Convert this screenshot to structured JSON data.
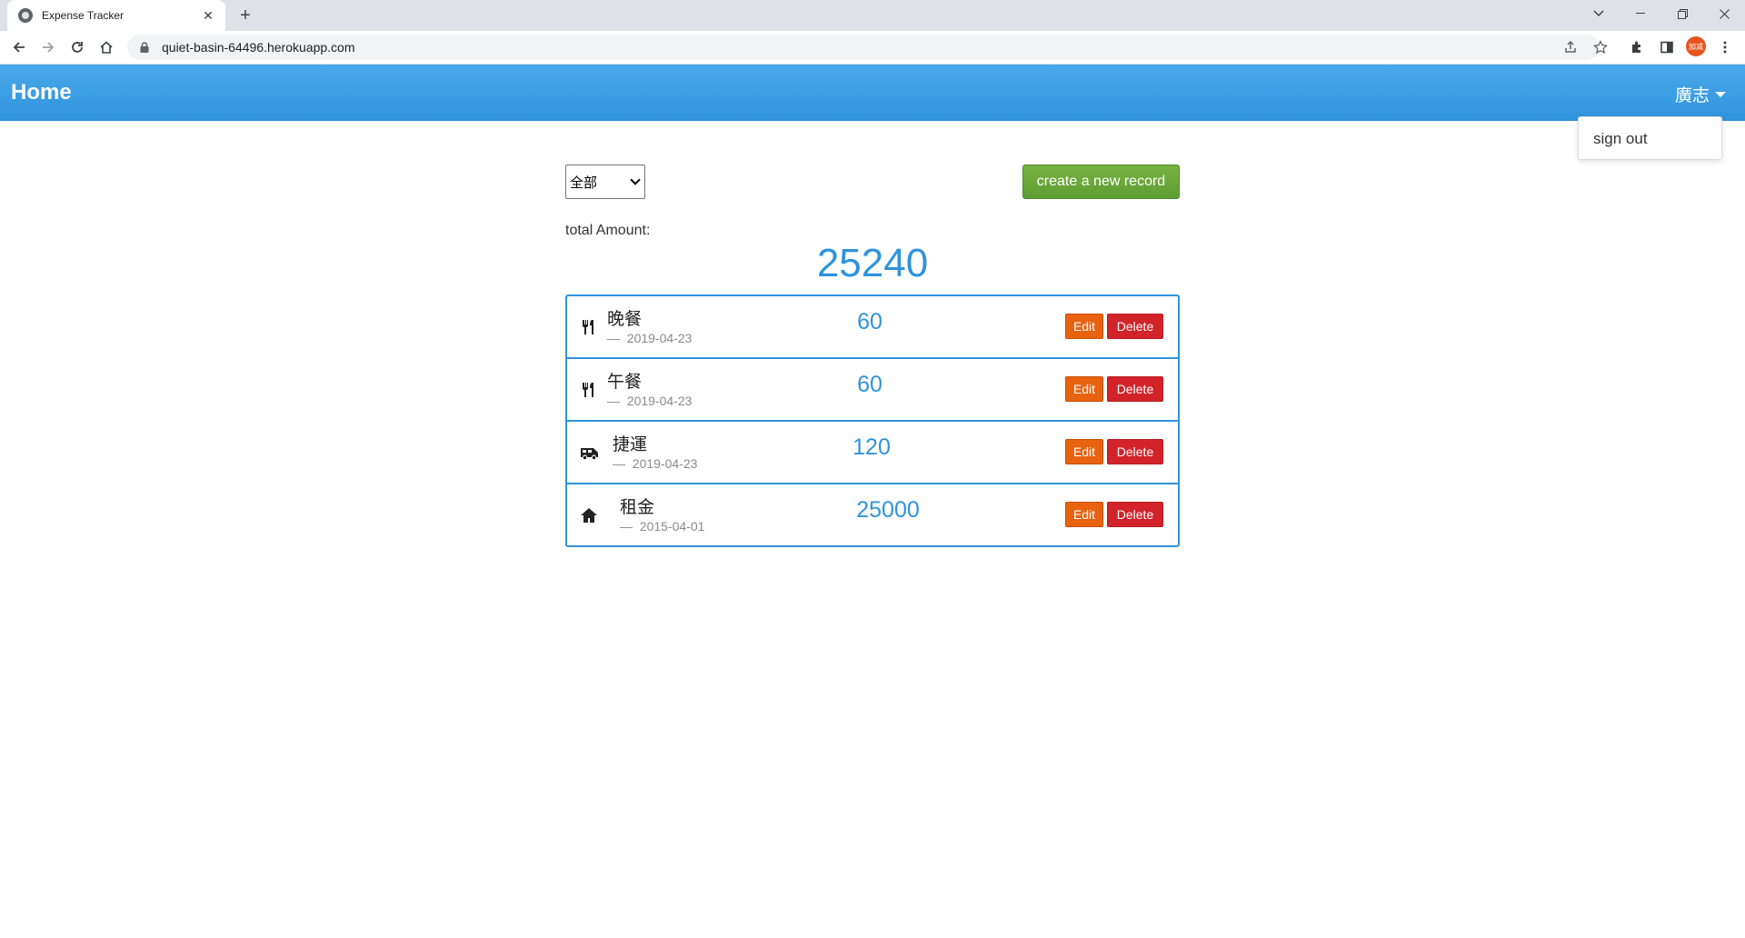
{
  "browser": {
    "tab_title": "Expense Tracker",
    "url": "quiet-basin-64496.herokuapp.com",
    "profile_initials": "加减"
  },
  "navbar": {
    "brand": "Home",
    "user_name": "廣志",
    "menu_items": [
      "sign out"
    ]
  },
  "filter": {
    "selected": "全部"
  },
  "create_button": "create a new record",
  "total": {
    "label": "total Amount:",
    "amount": "25240"
  },
  "records": [
    {
      "icon": "utensils-icon",
      "name": "晚餐",
      "date": "2019-04-23",
      "amount": "60",
      "edit": "Edit",
      "delete": "Delete"
    },
    {
      "icon": "utensils-icon",
      "name": "午餐",
      "date": "2019-04-23",
      "amount": "60",
      "edit": "Edit",
      "delete": "Delete"
    },
    {
      "icon": "shuttle-van-icon",
      "name": "捷運",
      "date": "2019-04-23",
      "amount": "120",
      "edit": "Edit",
      "delete": "Delete"
    },
    {
      "icon": "home-icon",
      "name": "租金",
      "date": "2015-04-01",
      "amount": "25000",
      "edit": "Edit",
      "delete": "Delete"
    }
  ],
  "colors": {
    "navbar": "#2f93dd",
    "accent": "#2f93dd",
    "create_button": "#6aaa3a",
    "edit_button": "#e8620f",
    "delete_button": "#d2232a"
  }
}
